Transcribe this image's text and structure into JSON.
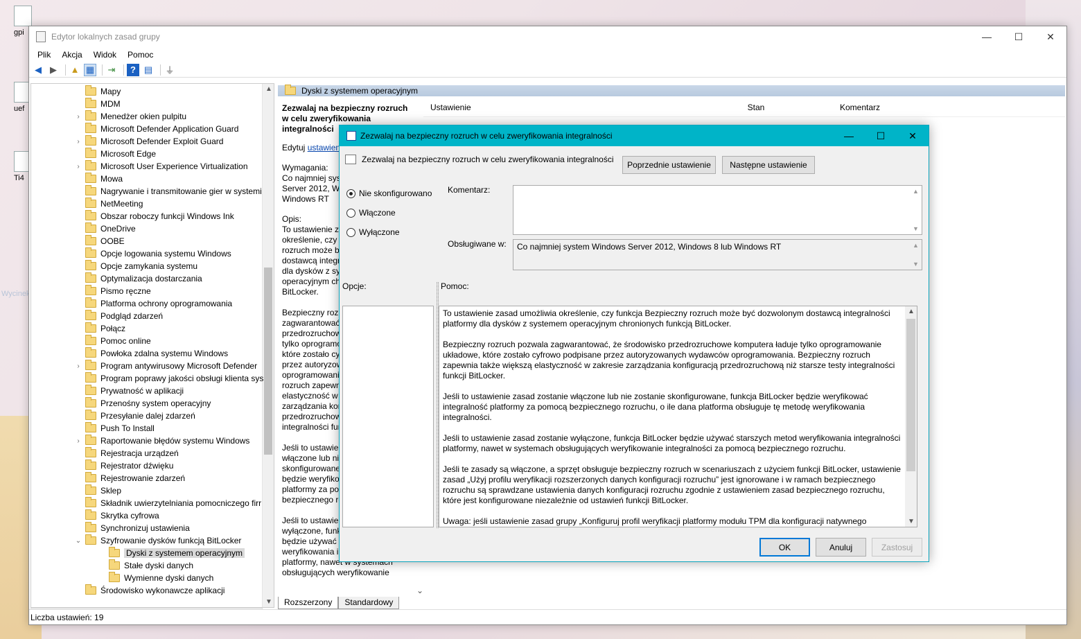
{
  "desktop": {
    "icons": [
      {
        "label": "gpi",
        "icon": "file-icon"
      },
      {
        "label": "uef",
        "icon": "file-icon"
      },
      {
        "label": "Ti4",
        "icon": "file-icon"
      }
    ],
    "ghost_text": "Wycinek prostokątny"
  },
  "main_window": {
    "title": "Edytor lokalnych zasad grupy",
    "menu": [
      "Plik",
      "Akcja",
      "Widok",
      "Pomoc"
    ],
    "tree": [
      {
        "label": "Mapy",
        "exp": false
      },
      {
        "label": "MDM",
        "exp": false
      },
      {
        "label": "Menedżer okien pulpitu",
        "exp": true
      },
      {
        "label": "Microsoft Defender Application Guard",
        "exp": false
      },
      {
        "label": "Microsoft Defender Exploit Guard",
        "exp": true
      },
      {
        "label": "Microsoft Edge",
        "exp": false
      },
      {
        "label": "Microsoft User Experience Virtualization",
        "exp": true
      },
      {
        "label": "Mowa",
        "exp": false
      },
      {
        "label": "Nagrywanie i transmitowanie gier w systemi",
        "exp": false
      },
      {
        "label": "NetMeeting",
        "exp": false
      },
      {
        "label": "Obszar roboczy funkcji Windows Ink",
        "exp": false
      },
      {
        "label": "OneDrive",
        "exp": false
      },
      {
        "label": "OOBE",
        "exp": false
      },
      {
        "label": "Opcje logowania systemu Windows",
        "exp": false
      },
      {
        "label": "Opcje zamykania systemu",
        "exp": false
      },
      {
        "label": "Optymalizacja dostarczania",
        "exp": false
      },
      {
        "label": "Pismo ręczne",
        "exp": false
      },
      {
        "label": "Platforma ochrony oprogramowania",
        "exp": false
      },
      {
        "label": "Podgląd zdarzeń",
        "exp": false
      },
      {
        "label": "Połącz",
        "exp": false
      },
      {
        "label": "Pomoc online",
        "exp": false
      },
      {
        "label": "Powłoka zdalna systemu Windows",
        "exp": false
      },
      {
        "label": "Program antywirusowy Microsoft Defender",
        "exp": true
      },
      {
        "label": "Program poprawy jakości obsługi klienta sys",
        "exp": false
      },
      {
        "label": "Prywatność w aplikacji",
        "exp": false
      },
      {
        "label": "Przenośny system operacyjny",
        "exp": false
      },
      {
        "label": "Przesyłanie dalej zdarzeń",
        "exp": false
      },
      {
        "label": "Push To Install",
        "exp": false
      },
      {
        "label": "Raportowanie błędów systemu Windows",
        "exp": true
      },
      {
        "label": "Rejestracja urządzeń",
        "exp": false
      },
      {
        "label": "Rejestrator dźwięku",
        "exp": false
      },
      {
        "label": "Rejestrowanie zdarzeń",
        "exp": false
      },
      {
        "label": "Sklep",
        "exp": false
      },
      {
        "label": "Składnik uwierzytelniania pomocniczego firr",
        "exp": false
      },
      {
        "label": "Skrytka cyfrowa",
        "exp": false
      },
      {
        "label": "Synchronizuj ustawienia",
        "exp": false
      },
      {
        "label": "Szyfrowanie dysków funkcją BitLocker",
        "exp": "open"
      },
      {
        "label": "Dyski z systemem operacyjnym",
        "child": true,
        "selected": true
      },
      {
        "label": "Stałe dyski danych",
        "child": true
      },
      {
        "label": "Wymienne dyski danych",
        "child": true
      },
      {
        "label": "Środowisko wykonawcze aplikacji",
        "exp": false
      }
    ],
    "pane_header": "Dyski z systemem operacyjnym",
    "extended": {
      "title": "Zezwalaj na bezpieczny rozruch w celu zweryfikowania integralności",
      "edit_prefix": "Edytuj",
      "edit_link": "ustawienie",
      "req_label": "Wymagania:",
      "req_text": "Co najmniej system Windows Server 2012, Windows 8 lub Windows RT",
      "desc_label": "Opis:",
      "desc_text": "To ustawienie zasad umożliwia określenie, czy funkcja Bezpieczny rozruch może być dozwolonym dostawcą integralności platformy dla dysków z systemem operacyjnym chronionych funkcją BitLocker.",
      "desc2": "Bezpieczny rozruch pozwala zagwarantować, że środowisko przedrozruchowe komputera ładuje tylko oprogramowanie układowe, które zostało cyfrowo podpisane przez autoryzowanych wydawców oprogramowania. Bezpieczny rozruch zapewnia także większą elastyczność w zakresie zarządzania konfiguracją przedrozruchową niż starsze testy integralności funkcji BitLocker.",
      "desc3": "Jeśli to ustawienie zasad zostanie włączone lub nie zostanie skonfigurowane, funkcja BitLocker będzie weryfikować integralność platformy za pomocą bezpiecznego rozruchu.",
      "desc4": "Jeśli to ustawienie zasad zostanie wyłączone, funkcja BitLocker będzie używać starszych metod weryfikowania integralności platformy, nawet w systemach obsługujących weryfikowanie"
    },
    "list_columns": [
      "Ustawienie",
      "Stan",
      "Komentarz"
    ],
    "tabs": [
      "Rozszerzony",
      "Standardowy"
    ],
    "status": "Liczba ustawień: 19"
  },
  "dialog": {
    "title": "Zezwalaj na bezpieczny rozruch w celu zweryfikowania integralności",
    "setting_name": "Zezwalaj na bezpieczny rozruch w celu zweryfikowania integralności",
    "prev_button": "Poprzednie ustawienie",
    "next_button": "Następne ustawienie",
    "radio_not_configured": "Nie skonfigurowano",
    "radio_enabled": "Włączone",
    "radio_disabled": "Wyłączone",
    "comment_label": "Komentarz:",
    "supported_label": "Obsługiwane w:",
    "supported_value": "Co najmniej system Windows Server 2012, Windows 8 lub Windows RT",
    "options_label": "Opcje:",
    "help_label": "Pomoc:",
    "help_paragraphs": [
      "To ustawienie zasad umożliwia określenie, czy funkcja Bezpieczny rozruch może być dozwolonym dostawcą integralności platformy dla dysków z systemem operacyjnym chronionych funkcją BitLocker.",
      "Bezpieczny rozruch pozwala zagwarantować, że środowisko przedrozruchowe komputera ładuje tylko oprogramowanie układowe, które zostało cyfrowo podpisane przez autoryzowanych wydawców oprogramowania. Bezpieczny rozruch zapewnia także większą elastyczność w zakresie zarządzania konfiguracją przedrozruchową niż starsze testy integralności funkcji BitLocker.",
      "Jeśli to ustawienie zasad zostanie włączone lub nie zostanie skonfigurowane, funkcja BitLocker będzie weryfikować integralność platformy za pomocą bezpiecznego rozruchu, o ile dana platforma obsługuje tę metodę weryfikowania integralności.",
      "Jeśli to ustawienie zasad zostanie wyłączone, funkcja BitLocker będzie używać starszych metod weryfikowania integralności platformy, nawet w systemach obsługujących weryfikowanie integralności za pomocą bezpiecznego rozruchu.",
      "Jeśli te zasady są włączone, a sprzęt obsługuje bezpieczny rozruch w scenariuszach z użyciem funkcji BitLocker, ustawienie zasad „Użyj profilu weryfikacji rozszerzonych danych konfiguracji rozruchu” jest ignorowane i w ramach bezpiecznego rozruchu są sprawdzane ustawienia danych konfiguracji rozruchu zgodnie z ustawieniem zasad bezpiecznego rozruchu, które jest konfigurowane niezależnie od ustawień funkcji BitLocker.",
      "Uwaga: jeśli ustawienie zasad grupy „Konfiguruj profil weryfikacji platformy modułu TPM dla konfiguracji natywnego oprogramowania układowego UEFI” jest włączone z pominięciem indeksu PCR 7, funkcja BitLocker nie może weryfikować integralności platformy ani danych konfiguracji rozruchu (BCD) za pomocą bezpiecznego rozruchu."
    ],
    "ok": "OK",
    "cancel": "Anuluj",
    "apply": "Zastosuj"
  }
}
